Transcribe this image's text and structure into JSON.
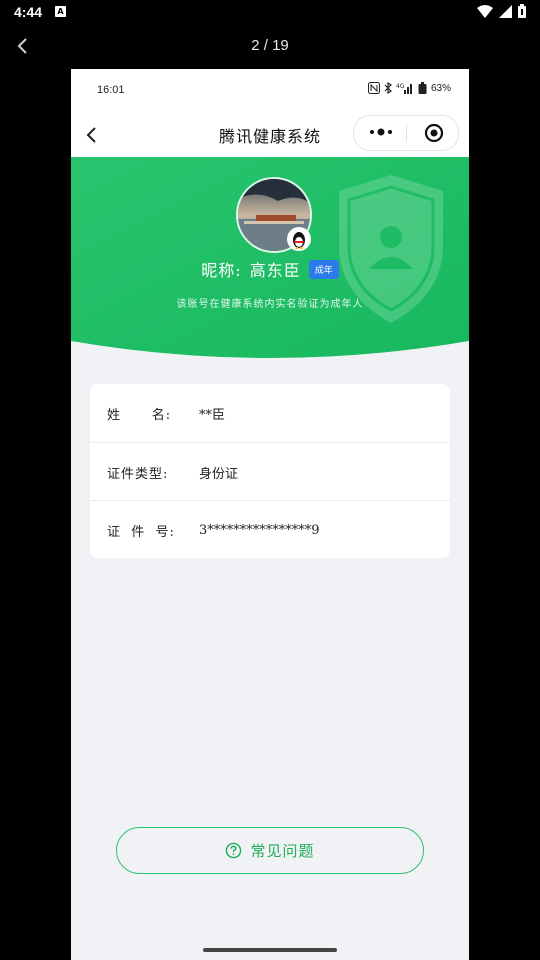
{
  "os_status": {
    "time": "4:44"
  },
  "viewer": {
    "counter": "2 / 19"
  },
  "phone_status": {
    "time": "16:01",
    "battery": "63%"
  },
  "nav": {
    "title": "腾讯健康系统"
  },
  "profile": {
    "nickname_label": "昵称:",
    "nickname": "高东臣",
    "badge": "成年",
    "note": "该账号在健康系统内实名验证为成年人"
  },
  "info": {
    "rows": [
      {
        "label": "姓      名:",
        "value": "**臣"
      },
      {
        "label": "证件类型:",
        "value": "身份证"
      },
      {
        "label": "证  件  号:",
        "value": "3****************9"
      }
    ]
  },
  "faq": {
    "label": "常见问题"
  },
  "colors": {
    "brand_green": "#22c066",
    "badge_blue": "#2d7bea",
    "page_bg": "#f1f2f5"
  }
}
